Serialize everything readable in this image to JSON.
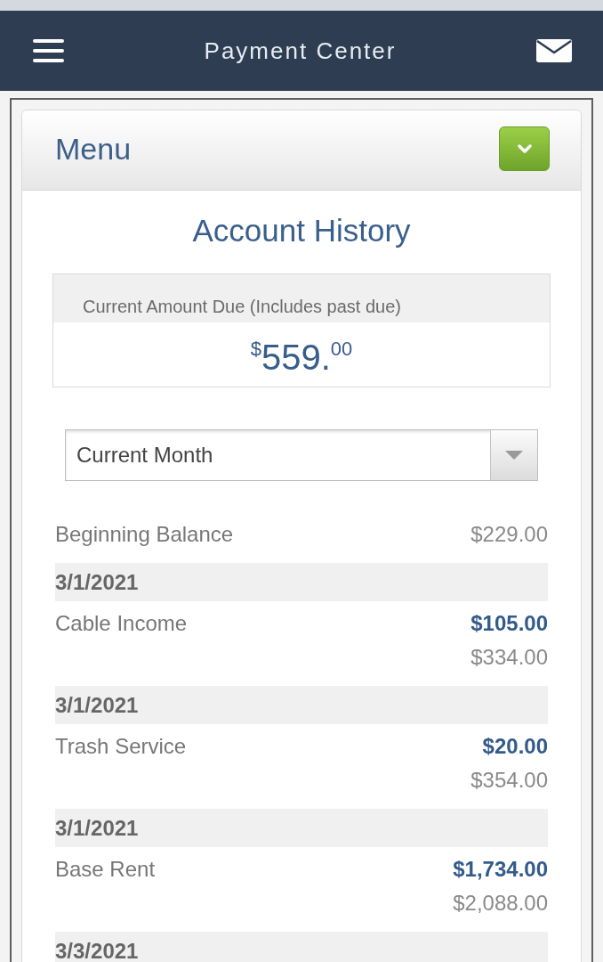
{
  "header": {
    "title": "Payment Center"
  },
  "menu": {
    "label": "Menu",
    "expanded": false
  },
  "page_title": "Account History",
  "amount_due": {
    "label": "Current Amount Due (Includes past due)",
    "amount": "$^{$}$559.$^{00}$"
  },
  "period_select": {
    "value": "Current Month"
  },
  "beginning_balance": {
    "label": "Beginning Balance",
    "value": "$229.00"
  },
  "entries": [
    {
      "date": "3/1/2021",
      "description": "Cable Income",
      "amount": "$105.00",
      "balance": "$334.00"
    },
    {
      "date": "3/1/2021",
      "description": "Trash Service",
      "amount": "$20.00",
      "balance": "$354.00"
    },
    {
      "date": "3/1/2021",
      "description": "Base Rent",
      "amount": "$1,734.00",
      "balance": "$2,088.00"
    },
    {
      "date": "3/3/2021"
    }
  ]
}
